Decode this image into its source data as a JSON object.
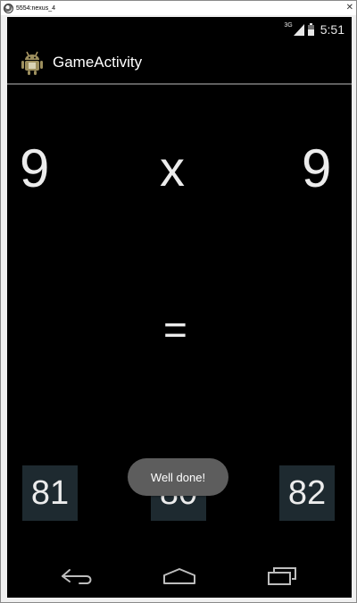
{
  "window": {
    "title": "5554:nexus_4",
    "close_glyph": "✕"
  },
  "status_bar": {
    "network_type": "3G",
    "time": "5:51"
  },
  "action_bar": {
    "title": "GameActivity",
    "icon": "android-robot-icon"
  },
  "equation": {
    "left_operand": "9",
    "operator": "x",
    "right_operand": "9",
    "equals": "="
  },
  "answers": [
    {
      "label": "81"
    },
    {
      "label": "80"
    },
    {
      "label": "82"
    }
  ],
  "toast": {
    "message": "Well done!"
  },
  "navigation": {
    "back": "back-icon",
    "home": "home-icon",
    "recents": "recents-icon"
  },
  "colors": {
    "screen_background": "#000000",
    "answer_button_background": "#1e2a30",
    "toast_background": "#5d5d5d",
    "text": "#ececec"
  }
}
